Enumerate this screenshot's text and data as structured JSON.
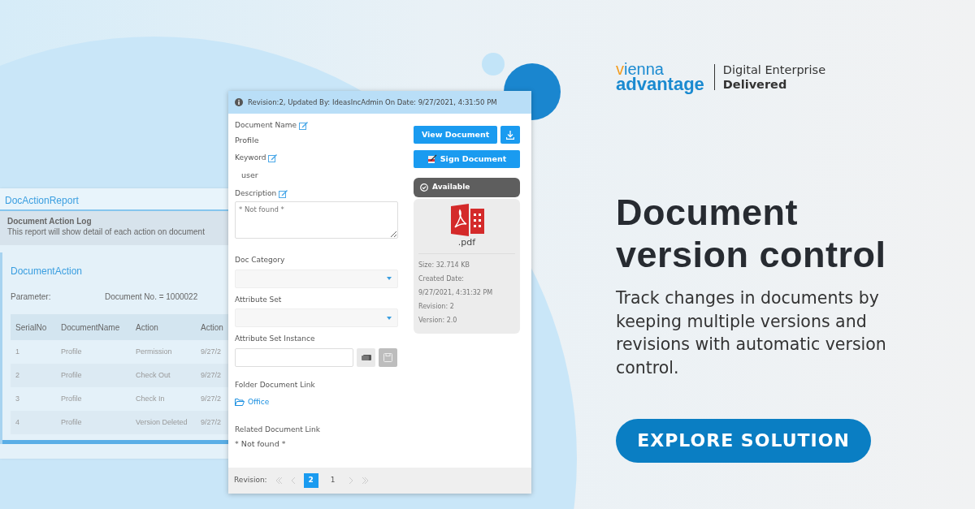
{
  "logo": {
    "line_1": "vienna",
    "line_2": "advantage",
    "tagline_1": "Digital Enterprise",
    "tagline_2": "Delivered"
  },
  "headline": "Document version control",
  "body": "Track changes in documents by keeping multiple versions and revisions with automatic version control.",
  "cta": "EXPLORE SOLUTION",
  "report": {
    "title": "DocActionReport",
    "heading": "Document Action Log",
    "description": "This report will show detail of each action on document",
    "section_title": "DocumentAction",
    "parameter_label": "Parameter:",
    "parameter_value": "Document No. = 1000022",
    "columns": [
      "SerialNo",
      "DocumentName",
      "Action",
      "Action"
    ],
    "rows": [
      [
        "1",
        "Profile",
        "Permission",
        "9/27/2"
      ],
      [
        "2",
        "Profile",
        "Check Out",
        "9/27/2"
      ],
      [
        "3",
        "Profile",
        "Check In",
        "9/27/2"
      ],
      [
        "4",
        "Profile",
        "Version Deleted",
        "9/27/2"
      ]
    ]
  },
  "document_panel": {
    "info": "Revision:2, Updated By: IdeasIncAdmin On Date: 9/27/2021, 4:31:50 PM",
    "fields": [
      {
        "kind": "text",
        "label": "Document Name",
        "editable": true,
        "value": "Profile"
      },
      {
        "kind": "indented",
        "label": "Keyword",
        "editable": true,
        "value": "user"
      },
      {
        "kind": "textarea",
        "label": "Description",
        "editable": true,
        "placeholder": "* Not found *"
      },
      {
        "kind": "select",
        "label": "Doc Category",
        "editable": false
      },
      {
        "kind": "select",
        "label": "Attribute Set",
        "editable": false
      },
      {
        "kind": "lookup",
        "label": "Attribute Set Instance",
        "editable": false,
        "buttons": [
          {
            "disabled": false
          },
          {
            "disabled": true
          }
        ]
      },
      {
        "kind": "folder",
        "label": "Folder Document Link",
        "editable": false,
        "value": "Office"
      },
      {
        "kind": "text",
        "label": "Related Document Link",
        "editable": false,
        "value": "* Not found *"
      }
    ],
    "view_button": "View Document",
    "sign_button": "Sign Document",
    "status": "Available",
    "file": {
      "extension": ".pdf",
      "details": [
        "Size: 32.714 KB",
        "Created Date:",
        "9/27/2021, 4:31:32 PM",
        "Revision: 2",
        "Version: 2.0"
      ]
    },
    "pagination": {
      "label": "Revision:",
      "pages": [
        {
          "label": "2",
          "selected": true
        },
        {
          "label": "1",
          "selected": false
        }
      ]
    }
  }
}
